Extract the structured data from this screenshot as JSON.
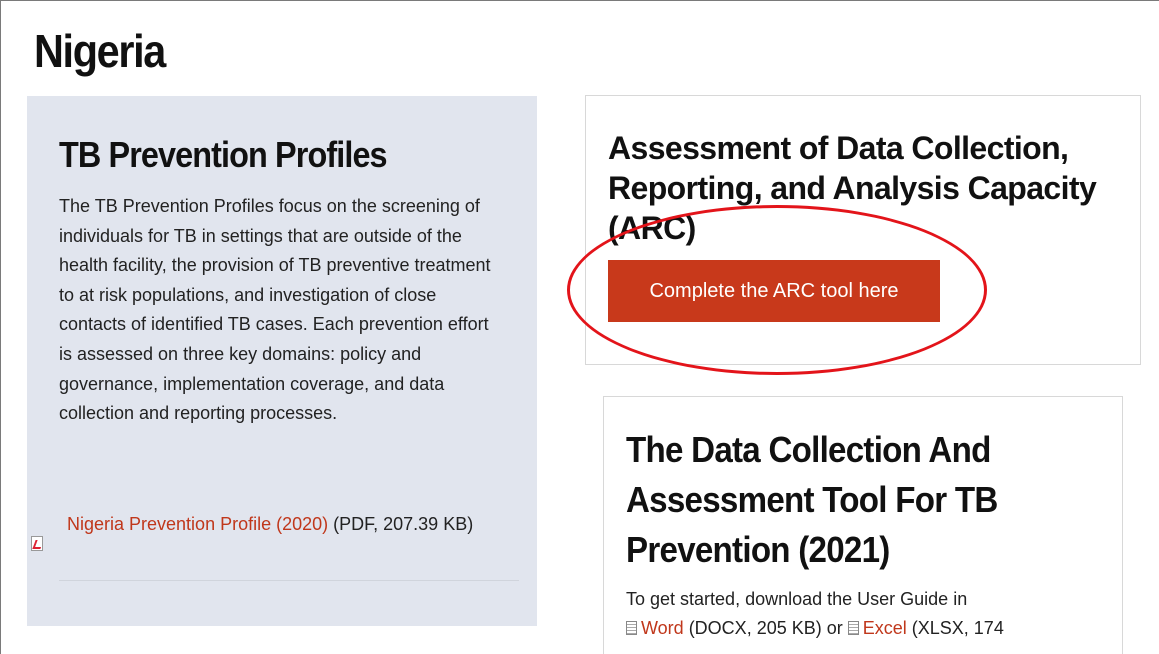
{
  "page": {
    "title": "Nigeria"
  },
  "prevention_profiles": {
    "heading": "TB Prevention Profiles",
    "description": "The TB Prevention Profiles focus on the screening of individuals for TB in settings that are outside of the health facility, the provision of TB preventive treatment to at risk populations, and investigation of close contacts of identified TB cases. Each prevention effort is assessed on three key domains: policy and governance, implementation coverage, and data collection and reporting processes.",
    "file_link": "Nigeria Prevention Profile (2020)",
    "file_meta": " (PDF, 207.39 KB)",
    "file_icon": "pdf-icon"
  },
  "arc": {
    "heading": "Assessment of Data Collection, Reporting, and Analysis Capacity (ARC)",
    "button_label": "Complete the ARC tool here",
    "button_color": "#c8391b",
    "annotation_color": "#e3141a"
  },
  "tool": {
    "heading": "The Data Collection And Assessment Tool For TB Prevention (2021)",
    "intro_text": "To get started, download the User Guide in",
    "word_link": "Word",
    "word_meta": " (DOCX, 205 KB) or ",
    "excel_link": "Excel",
    "excel_meta": " (XLSX, 174",
    "link_color": "#c0371b"
  }
}
